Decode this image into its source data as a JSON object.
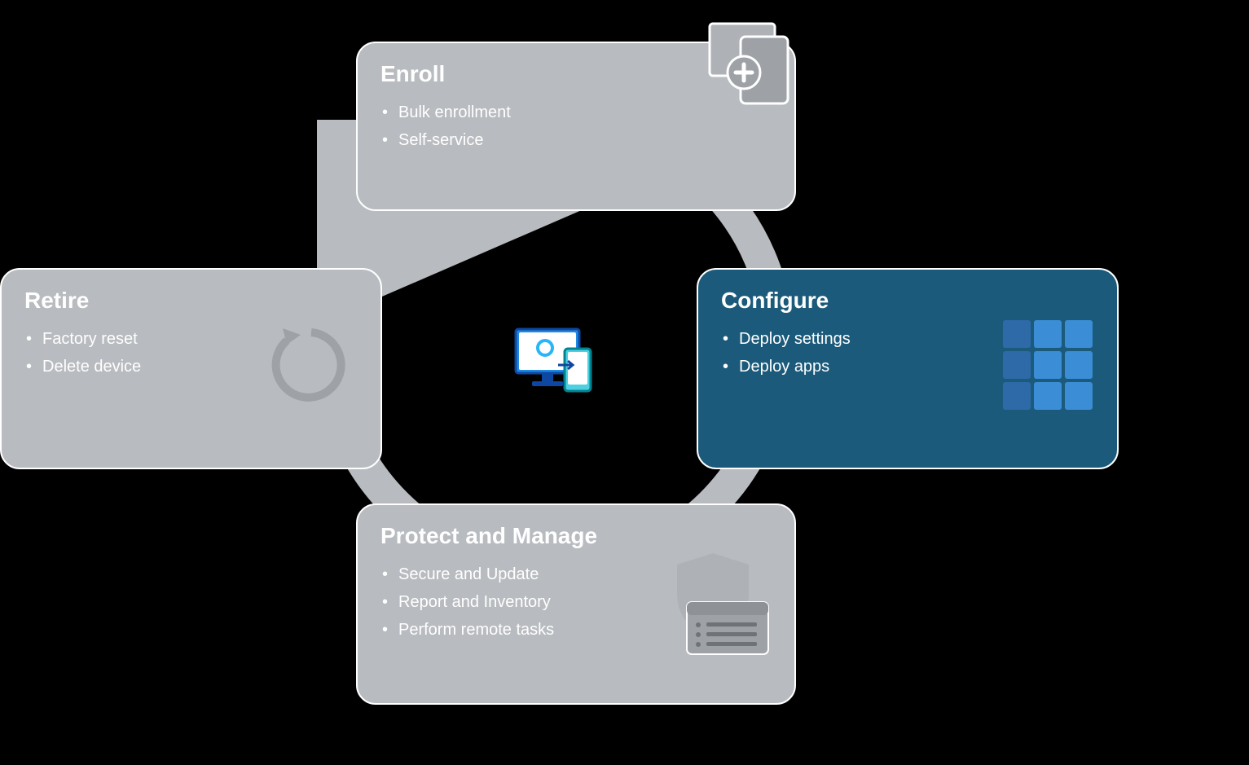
{
  "cycle": {
    "enroll": {
      "title": "Enroll",
      "items": [
        "Bulk enrollment",
        "Self-service"
      ],
      "active": false
    },
    "configure": {
      "title": "Configure",
      "items": [
        "Deploy settings",
        "Deploy apps"
      ],
      "active": true
    },
    "protect": {
      "title": "Protect and Manage",
      "items": [
        "Secure and Update",
        "Report and Inventory",
        "Perform remote tasks"
      ],
      "active": false
    },
    "retire": {
      "title": "Retire",
      "items": [
        "Factory reset",
        "Delete device"
      ],
      "active": false
    }
  }
}
